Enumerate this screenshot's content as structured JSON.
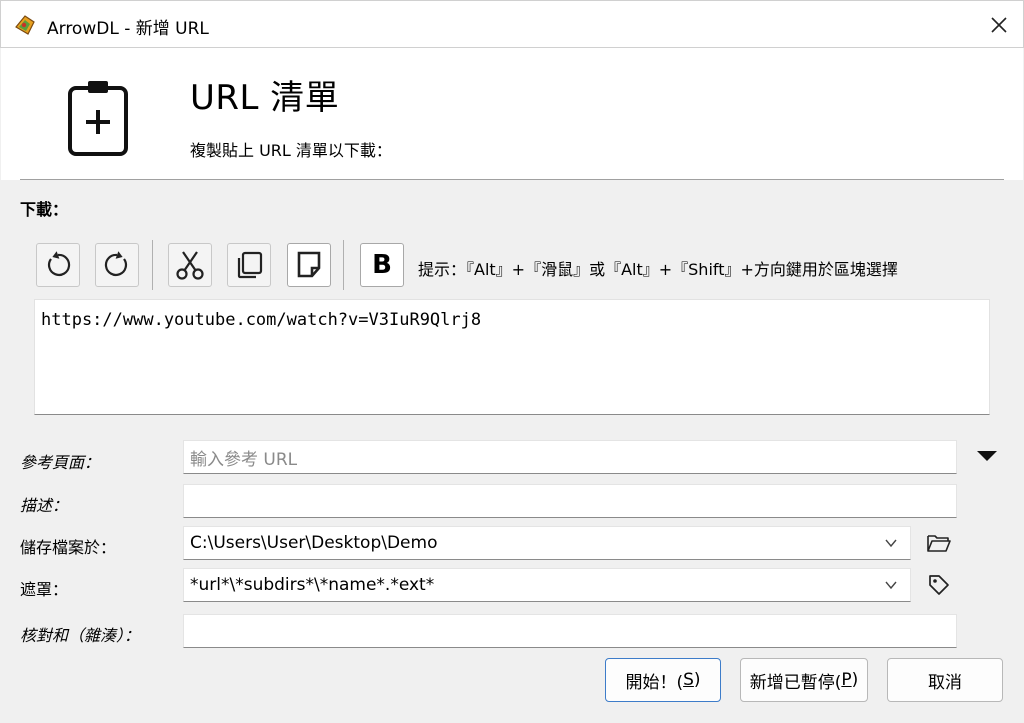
{
  "window": {
    "title": "ArrowDL - 新增 URL",
    "app_icon": "arrowdl-app-icon",
    "close_icon": "close-icon"
  },
  "header": {
    "icon": "clipboard-plus-icon",
    "title": "URL 清單",
    "subtitle": "複製貼上 URL 清單以下載："
  },
  "download_section": {
    "label": "下載："
  },
  "toolbar": {
    "buttons": [
      {
        "name": "undo-icon"
      },
      {
        "name": "redo-icon"
      },
      {
        "name": "cut-icon"
      },
      {
        "name": "copy-icon"
      },
      {
        "name": "paste-icon"
      },
      {
        "name": "bold-icon",
        "label": "B"
      }
    ],
    "hint": "提示：『Alt』+『滑鼠』或『Alt』+『Shift』+方向鍵用於區塊選擇"
  },
  "url_list": {
    "value": "https://www.youtube.com/watch?v=V3IuR9Qlrj8"
  },
  "form": {
    "referrer": {
      "label": "參考頁面：",
      "value": "",
      "placeholder": "輸入參考 URL"
    },
    "description": {
      "label": "描述：",
      "value": ""
    },
    "save_to": {
      "label": "儲存檔案於：",
      "value": "C:\\Users\\User\\Desktop\\Demo"
    },
    "mask": {
      "label": "遮罩：",
      "value": "*url*\\*subdirs*\\*name*.*ext*"
    },
    "checksum": {
      "label": "核對和（雜湊）：",
      "value": ""
    }
  },
  "buttons": {
    "start": {
      "label": "開始！(",
      "mnemonic": "S",
      "suffix": ")"
    },
    "add_paused": {
      "label": "新增已暫停(",
      "mnemonic": "P",
      "suffix": ")"
    },
    "cancel": {
      "label": "取消"
    }
  },
  "colors": {
    "accent": "#3d7cc9",
    "background": "#f0f0f0"
  }
}
